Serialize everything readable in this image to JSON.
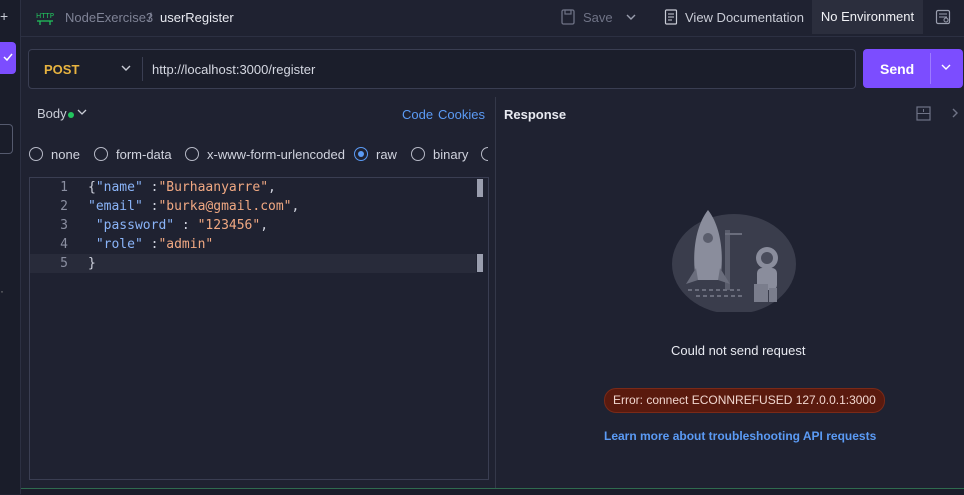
{
  "breadcrumb": {
    "collection": "NodeExercise3",
    "separator": "/",
    "request": "userRegister"
  },
  "toolbar": {
    "save_label": "Save",
    "docs_label": "View Documentation",
    "environment_label": "No Environment"
  },
  "request": {
    "method": "POST",
    "url": "http://localhost:3000/register",
    "send_label": "Send"
  },
  "body_panel": {
    "tab_label": "Body",
    "code_link": "Code",
    "cookies_link": "Cookies",
    "body_types": [
      "none",
      "form-data",
      "x-www-form-urlencoded",
      "raw",
      "binary"
    ],
    "selected_type": "raw",
    "editor_lines": [
      {
        "n": "1",
        "key": "\"name\"",
        "sep": " :",
        "val": "\"Burhaanyarre\"",
        "tail": ",",
        "lead": "{"
      },
      {
        "n": "2",
        "key": "\"email\"",
        "sep": " :",
        "val": "\"burka@gmail.com\"",
        "tail": ",",
        "lead": ""
      },
      {
        "n": "3",
        "key": "\"password\"",
        "sep": " : ",
        "val": "\"123456\"",
        "tail": ",",
        "lead": " "
      },
      {
        "n": "4",
        "key": "\"role\"",
        "sep": " :",
        "val": "\"admin\"",
        "tail": "",
        "lead": " "
      },
      {
        "n": "5",
        "key": "",
        "sep": "",
        "val": "",
        "tail": "}",
        "lead": ""
      }
    ]
  },
  "response": {
    "title": "Response",
    "message": "Could not send request",
    "error": "Error: connect ECONNREFUSED 127.0.0.1:3000",
    "learn_more": "Learn more about troubleshooting API requests"
  },
  "colors": {
    "accent": "#7c4dff",
    "method": "#e8b440",
    "link": "#5b9bf5",
    "error_bg": "#5a1a0e"
  }
}
